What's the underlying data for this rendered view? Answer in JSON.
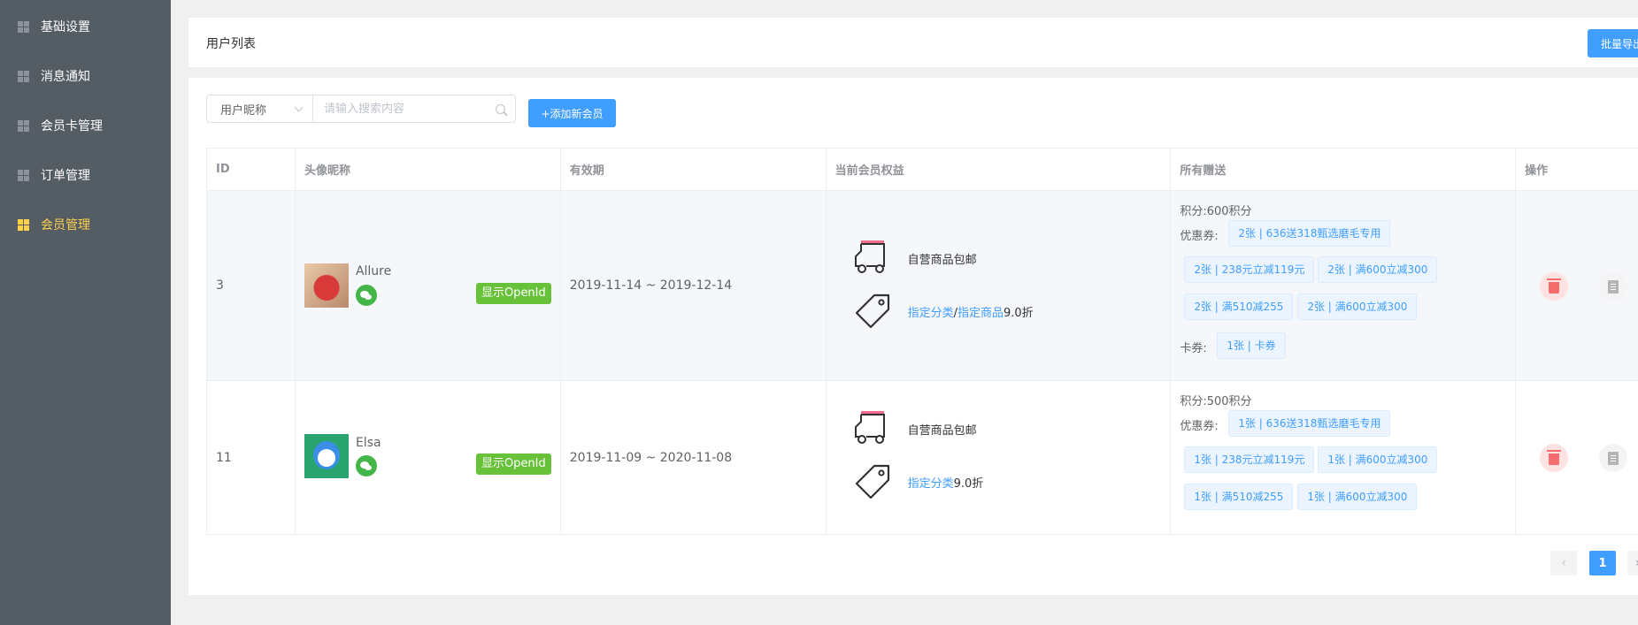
{
  "sidebar": {
    "items": [
      {
        "label": "基础设置",
        "active": false
      },
      {
        "label": "消息通知",
        "active": false
      },
      {
        "label": "会员卡管理",
        "active": false
      },
      {
        "label": "订单管理",
        "active": false
      },
      {
        "label": "会员管理",
        "active": true
      }
    ],
    "accent_color": "#ffd04b",
    "background": "#545c64"
  },
  "header": {
    "title": "用户列表",
    "export_label": "批量导出"
  },
  "toolbar": {
    "select_value": "用户昵称",
    "search_placeholder": "请输入搜索内容",
    "add_label": "+添加新会员"
  },
  "table": {
    "columns": [
      "ID",
      "头像昵称",
      "有效期",
      "当前会员权益",
      "所有赠送",
      "操作"
    ],
    "rows": [
      {
        "id": "3",
        "nickname": "Allure",
        "openid_label": "显示OpenId",
        "validity": "2019-11-14 ~ 2019-12-14",
        "rights": {
          "shipping": "自营商品包邮",
          "discount_link1": "指定分类",
          "discount_sep": "/",
          "discount_link2": "指定商品",
          "discount_value": "9.0折"
        },
        "gifts": {
          "points": "积分:600积分",
          "coupon_label": "优惠券:",
          "coupons": [
            "2张 | 636送318甄选磨毛专用",
            "2张 | 238元立减119元",
            "2张 | 满600立减300",
            "2张 | 满510减255",
            "2张 | 满600立减300"
          ],
          "card_label": "卡券:",
          "cards": [
            "1张 | 卡券"
          ]
        }
      },
      {
        "id": "11",
        "nickname": "Elsa",
        "openid_label": "显示OpenId",
        "validity": "2019-11-09 ~ 2020-11-08",
        "rights": {
          "shipping": "自营商品包邮",
          "discount_link1": "指定分类",
          "discount_value": "9.0折"
        },
        "gifts": {
          "points": "积分:500积分",
          "coupon_label": "优惠券:",
          "coupons": [
            "1张 | 636送318甄选磨毛专用",
            "1张 | 238元立减119元",
            "1张 | 满600立减300",
            "1张 | 满510减255",
            "1张 | 满600立减300"
          ]
        }
      }
    ]
  },
  "pagination": {
    "prev": "‹",
    "current": "1",
    "next": "›"
  },
  "colors": {
    "primary": "#409eff",
    "success": "#67c23a",
    "danger": "#f56c6c"
  }
}
